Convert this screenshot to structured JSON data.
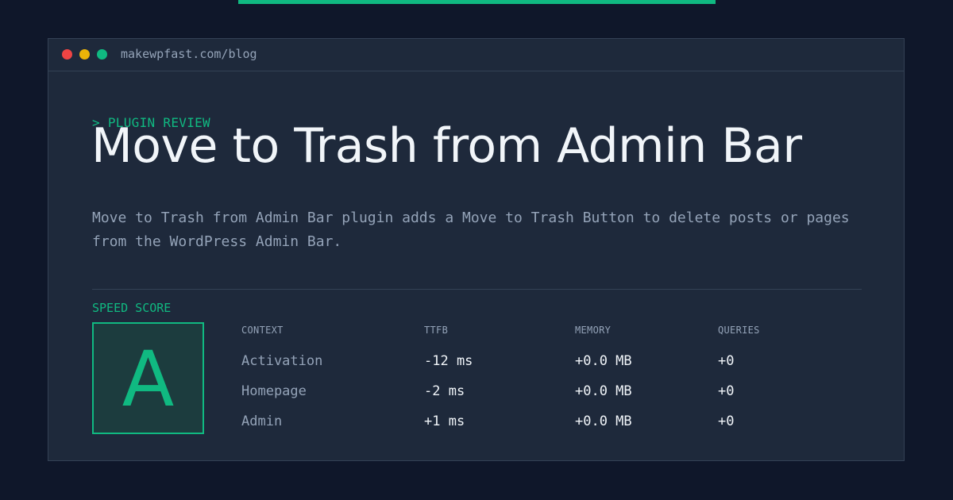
{
  "window": {
    "url": "makewpfast.com/blog",
    "dot_colors": [
      "#ef4444",
      "#eab308",
      "#10b981"
    ]
  },
  "article": {
    "eyebrow": "> PLUGIN REVIEW",
    "title": "Move to Trash from Admin Bar",
    "description": "Move to Trash from Admin Bar plugin adds a Move to Trash Button to delete posts or pages from the WordPress Admin Bar."
  },
  "score": {
    "label": "SPEED SCORE",
    "grade": "A"
  },
  "metrics": {
    "headers": [
      "CONTEXT",
      "TTFB",
      "MEMORY",
      "QUERIES"
    ],
    "rows": [
      [
        "Activation",
        "-12 ms",
        "+0.0 MB",
        "+0"
      ],
      [
        "Homepage",
        "-2 ms",
        "+0.0 MB",
        "+0"
      ],
      [
        "Admin",
        "+1 ms",
        "+0.0 MB",
        "+0"
      ]
    ]
  },
  "colors": {
    "accent": "#10b981",
    "background": "#0f172a",
    "panel": "#1e293b"
  }
}
